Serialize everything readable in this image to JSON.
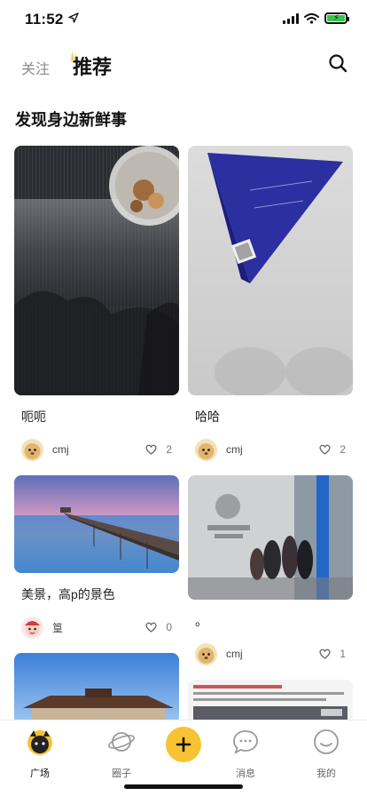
{
  "status_bar": {
    "time": "11:52"
  },
  "header": {
    "tab_follow": "关注",
    "tab_recommend": "推荐"
  },
  "section_title": "发现身边新鲜事",
  "cards": [
    {
      "title": "呃呃",
      "author": "cmj",
      "likes": "2"
    },
    {
      "title": "哈哈",
      "author": "cmj",
      "likes": "2"
    },
    {
      "title": "美景，高p的景色",
      "author": "篁",
      "likes": "0"
    },
    {
      "title": "。",
      "author": "cmj",
      "likes": "1"
    }
  ],
  "tabbar": {
    "square": "广场",
    "circle": "圈子",
    "messages": "消息",
    "mine": "我的"
  },
  "colors": {
    "accent": "#f7c233"
  }
}
